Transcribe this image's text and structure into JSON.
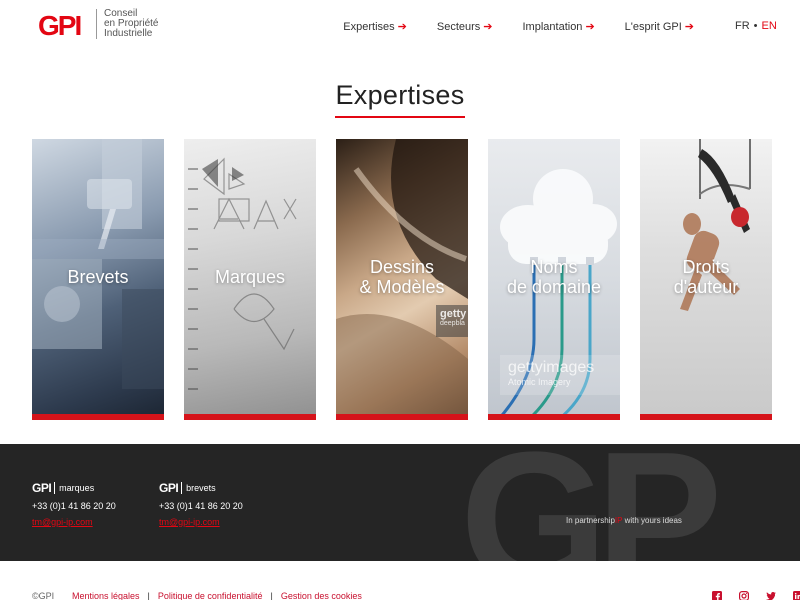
{
  "header": {
    "logo": {
      "mark": "GPI",
      "line1": "Conseil",
      "line2": "en Propriété",
      "line3": "Industrielle"
    },
    "nav": [
      {
        "label": "Expertises",
        "arrow": "➔"
      },
      {
        "label": "Secteurs",
        "arrow": "➔"
      },
      {
        "label": "Implantation",
        "arrow": "➔"
      },
      {
        "label": "L'esprit GPI",
        "arrow": "➔"
      }
    ],
    "lang": {
      "fr": "FR",
      "dot": "•",
      "en": "EN",
      "active": "EN"
    }
  },
  "main": {
    "title": "Expertises",
    "cards": [
      {
        "line1": "Brevets",
        "line2": ""
      },
      {
        "line1": "Marques",
        "line2": ""
      },
      {
        "line1": "Dessins",
        "line2": "& Modèles",
        "watermark1": "getty",
        "watermark2": "deepbla"
      },
      {
        "line1": "Noms",
        "line2": "de domaine",
        "watermark1": "gettyimages",
        "watermark2": "Atomic Imagery"
      },
      {
        "line1": "Droits",
        "line2": "d'auteur"
      }
    ]
  },
  "footer": {
    "contacts": [
      {
        "mark": "GPI",
        "division": "marques",
        "phone": "+33 (0)1 41 86 20 20",
        "email": "tm@gpi-ip.com"
      },
      {
        "mark": "GPI",
        "division": "brevets",
        "phone": "+33 (0)1 41 86 20 20",
        "email": "tm@gpi-ip.com"
      }
    ],
    "partnership": {
      "before": "In partnership",
      "ip": "IP",
      "after": " with yours ideas"
    },
    "copyright": "©GPI",
    "legal": [
      {
        "label": "Mentions légales"
      },
      {
        "label": "Politique de confidentialité"
      },
      {
        "label": "Gestion des cookies"
      }
    ],
    "separator": "|",
    "social": [
      "facebook-icon",
      "instagram-icon",
      "twitter-icon",
      "linkedin-icon"
    ]
  },
  "colors": {
    "accent": "#e30613",
    "dark": "#252525"
  }
}
